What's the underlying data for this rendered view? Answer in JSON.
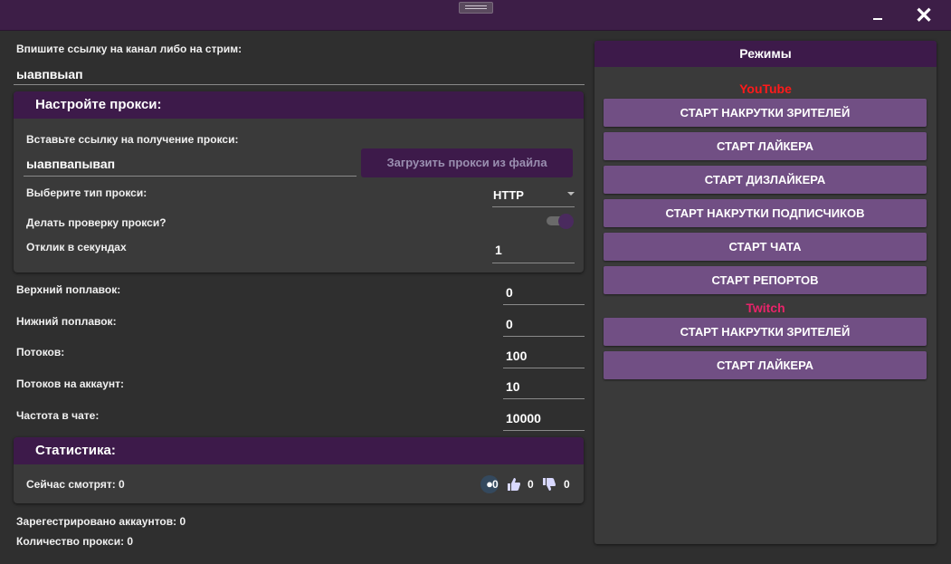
{
  "colors": {
    "titlebar": "#3d1e47",
    "background": "#2f2f2f",
    "card": "#3a3a3a",
    "card_header": "#3d1a4a",
    "mode_button": "#714f84",
    "youtube": "#ff1a1a",
    "twitch": "#e8246a"
  },
  "window": {
    "minimize_icon": "minimize-icon",
    "close_icon": "close-icon",
    "close_glyph": "✕"
  },
  "channel": {
    "label": "Впишите ссылку на канал либо на стрим:",
    "value": "ыавпвыап"
  },
  "proxy": {
    "title": "Настройте прокси:",
    "link_label": "Вставьте ссылку на получение прокси:",
    "link_value": "ыавпвапывап",
    "load_button": "Загрузить прокси из файла",
    "type_label": "Выберите тип прокси:",
    "type_value": "HTTP",
    "check_label": "Делать проверку прокси?",
    "check_enabled": true,
    "response_label": "Отклик в секундах",
    "response_value": "1"
  },
  "settings": [
    {
      "label": "Верхний поплавок:",
      "value": "0"
    },
    {
      "label": "Нижний поплавок:",
      "value": "0"
    },
    {
      "label": "Потоков:",
      "value": "100"
    },
    {
      "label": "Потоков на аккаунт:",
      "value": "10"
    },
    {
      "label": "Частота в чате:",
      "value": "10000"
    }
  ],
  "stats": {
    "title": "Статистика:",
    "watching": "Сейчас смотрят: 0",
    "viewers_icon": "viewers-icon",
    "viewers": "0",
    "likes_icon": "thumbs-up-icon",
    "likes": "0",
    "dislikes_icon": "thumbs-down-icon",
    "dislikes": "0",
    "registered": "Зарегестрировано аккаунтов: 0",
    "proxy_count": "Количество прокси: 0"
  },
  "modes": {
    "title": "Режимы",
    "youtube_label": "YouTube",
    "youtube_buttons": [
      "СТАРТ НАКРУТКИ ЗРИТЕЛЕЙ",
      "СТАРТ ЛАЙКЕРА",
      "СТАРТ ДИЗЛАЙКЕРА",
      "СТАРТ НАКРУТКИ ПОДПИСЧИКОВ",
      "СТАРТ ЧАТА",
      "СТАРТ РЕПОРТОВ"
    ],
    "twitch_label": "Twitch",
    "twitch_buttons": [
      "СТАРТ НАКРУТКИ ЗРИТЕЛЕЙ",
      "СТАРТ ЛАЙКЕРА"
    ]
  }
}
